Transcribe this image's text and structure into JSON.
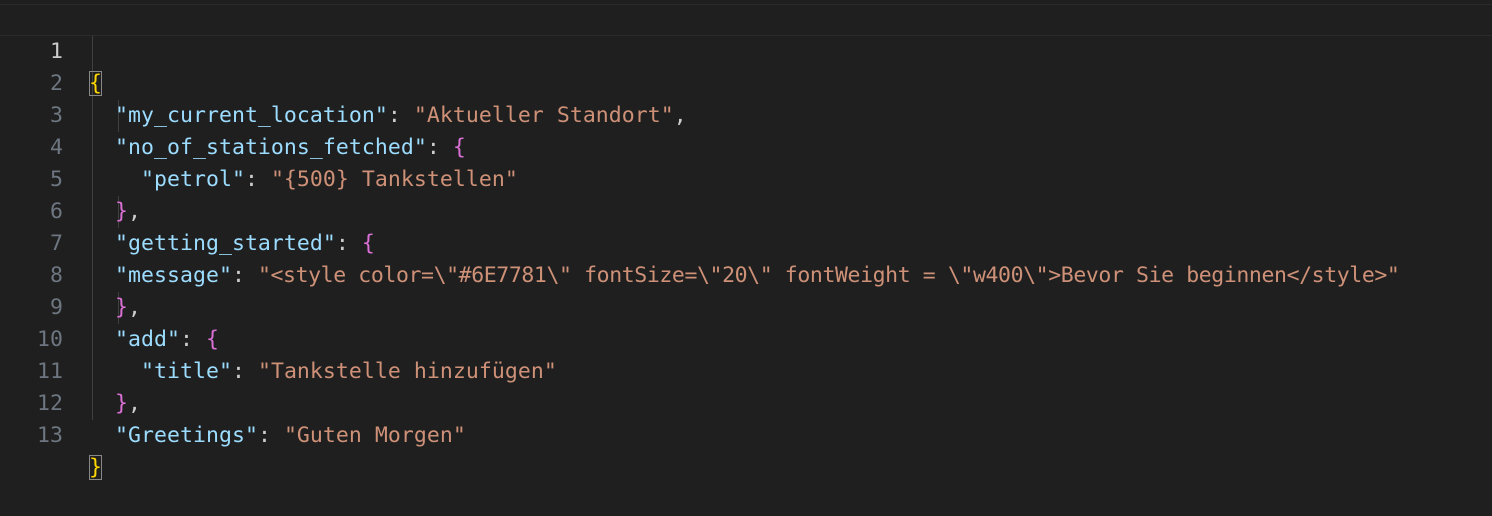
{
  "editor": {
    "lines": [
      {
        "num": "1",
        "open": "{"
      },
      {
        "num": "2",
        "key": "\"my_current_location\"",
        "colon": ": ",
        "value": "\"Aktueller Standort\"",
        "comma": ","
      },
      {
        "num": "3",
        "key": "\"no_of_stations_fetched\"",
        "colon": ": ",
        "open": "{"
      },
      {
        "num": "4",
        "key": "\"petrol\"",
        "colon": ": ",
        "value": "\"{500} Tankstellen\""
      },
      {
        "num": "5",
        "close": "}",
        "comma": ","
      },
      {
        "num": "6",
        "key": "\"getting_started\"",
        "colon": ": ",
        "open": "{"
      },
      {
        "num": "7",
        "key": "\"message\"",
        "colon": ": ",
        "value": "\"<style color=\\\"#6E7781\\\" fontSize=\\\"20\\\" fontWeight = \\\"w400\\\">Bevor Sie beginnen</style>\""
      },
      {
        "num": "8",
        "close": "}",
        "comma": ","
      },
      {
        "num": "9",
        "key": "\"add\"",
        "colon": ": ",
        "open": "{"
      },
      {
        "num": "10",
        "key": "\"title\"",
        "colon": ": ",
        "value": "\"Tankstelle hinzufügen\""
      },
      {
        "num": "11",
        "close": "}",
        "comma": ","
      },
      {
        "num": "12",
        "key": "\"Greetings\"",
        "colon": ": ",
        "value": "\"Guten Morgen\""
      },
      {
        "num": "13",
        "close": "}"
      }
    ]
  },
  "colors": {
    "background": "#1f1f1f",
    "line_number": "#6e7681",
    "line_number_active": "#cccccc",
    "json_key": "#9cdcfe",
    "json_string": "#ce9178",
    "bracket_level_1": "#ffd700",
    "bracket_level_2": "#da70d6",
    "punctuation": "#cccccc"
  }
}
